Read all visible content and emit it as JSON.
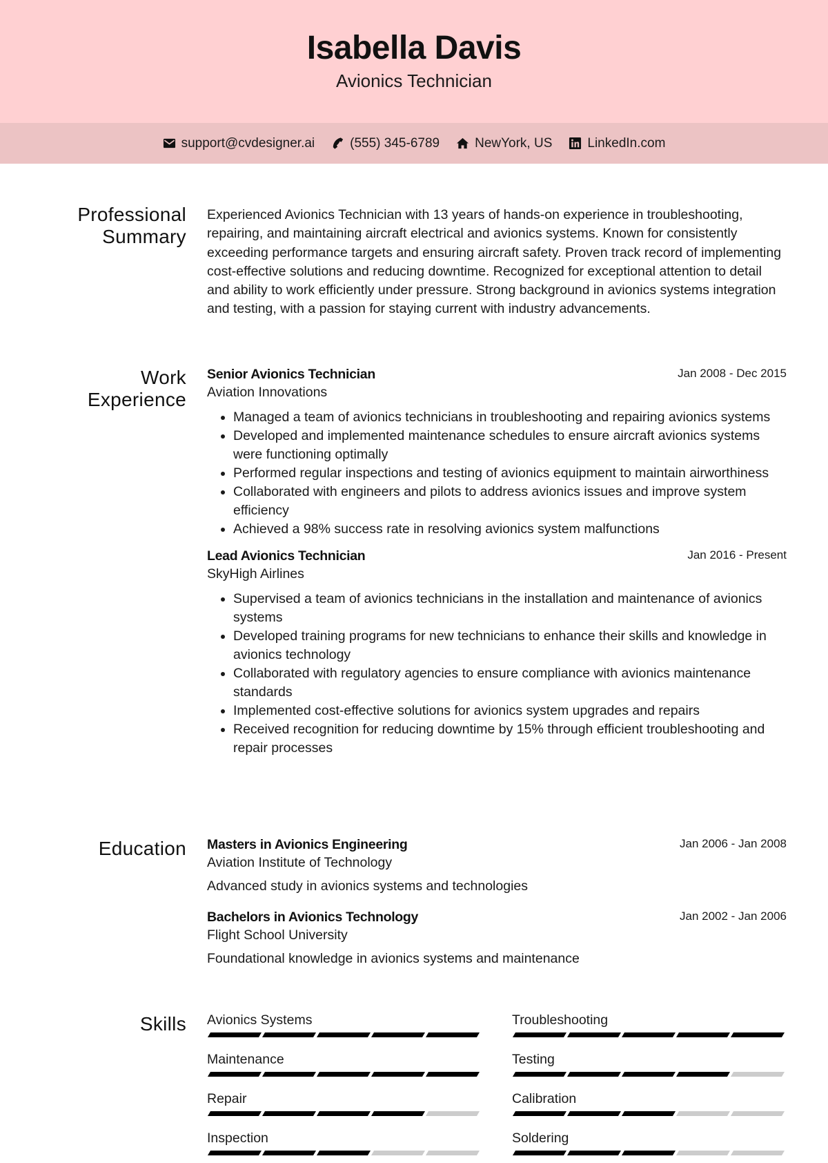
{
  "header": {
    "name": "Isabella Davis",
    "role": "Avionics Technician"
  },
  "contact": [
    {
      "icon": "envelope-icon",
      "text": "support@cvdesigner.ai"
    },
    {
      "icon": "phone-icon",
      "text": "(555) 345-6789"
    },
    {
      "icon": "home-icon",
      "text": "NewYork, US"
    },
    {
      "icon": "linkedin-icon",
      "text": "LinkedIn.com"
    }
  ],
  "summary": {
    "title_line1": "Professional",
    "title_line2": "Summary",
    "text": "Experienced Avionics Technician with 13 years of hands-on experience in troubleshooting, repairing, and maintaining aircraft electrical and avionics systems. Known for consistently exceeding performance targets and ensuring aircraft safety. Proven track record of implementing cost-effective solutions and reducing downtime. Recognized for exceptional attention to detail and ability to work efficiently under pressure. Strong background in avionics systems integration and testing, with a passion for staying current with industry advancements."
  },
  "experience": {
    "title_line1": "Work",
    "title_line2": "Experience",
    "jobs": [
      {
        "title": "Senior Avionics Technician",
        "company": "Aviation Innovations",
        "date": "Jan 2008 - Dec 2015",
        "bullets": [
          "Managed a team of avionics technicians in troubleshooting and repairing avionics systems",
          "Developed and implemented maintenance schedules to ensure aircraft avionics systems were functioning optimally",
          "Performed regular inspections and testing of avionics equipment to maintain airworthiness",
          "Collaborated with engineers and pilots to address avionics issues and improve system efficiency",
          "Achieved a 98% success rate in resolving avionics system malfunctions"
        ]
      },
      {
        "title": "Lead Avionics Technician",
        "company": "SkyHigh Airlines",
        "date": "Jan 2016 - Present",
        "bullets": [
          "Supervised a team of avionics technicians in the installation and maintenance of avionics systems",
          "Developed training programs for new technicians to enhance their skills and knowledge in avionics technology",
          "Collaborated with regulatory agencies to ensure compliance with avionics maintenance standards",
          "Implemented cost-effective solutions for avionics system upgrades and repairs",
          "Received recognition for reducing downtime by 15% through efficient troubleshooting and repair processes"
        ]
      }
    ]
  },
  "education": {
    "title": "Education",
    "items": [
      {
        "degree": "Masters in Avionics Engineering",
        "school": "Aviation Institute of Technology",
        "date": "Jan 2006 - Jan 2008",
        "description": "Advanced study in avionics systems and technologies"
      },
      {
        "degree": "Bachelors in Avionics Technology",
        "school": "Flight School University",
        "date": "Jan 2002 - Jan 2006",
        "description": "Foundational knowledge in avionics systems and maintenance"
      }
    ]
  },
  "skills": {
    "title": "Skills",
    "max_level": 5,
    "items": [
      {
        "name": "Avionics Systems",
        "level": 5
      },
      {
        "name": "Troubleshooting",
        "level": 5
      },
      {
        "name": "Maintenance",
        "level": 5
      },
      {
        "name": "Testing",
        "level": 4
      },
      {
        "name": "Repair",
        "level": 4
      },
      {
        "name": "Calibration",
        "level": 3
      },
      {
        "name": "Inspection",
        "level": 3
      },
      {
        "name": "Soldering",
        "level": 3
      }
    ]
  }
}
